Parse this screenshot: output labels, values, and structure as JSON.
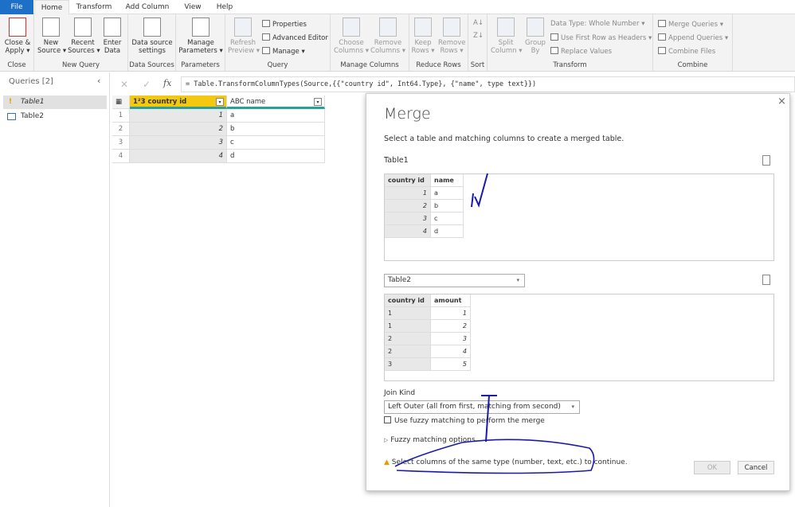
{
  "tabs": [
    "File",
    "Home",
    "Transform",
    "Add Column",
    "View",
    "Help"
  ],
  "ribbon": {
    "close": {
      "label": "Close",
      "btn": "Close &\nApply ▾"
    },
    "new_query": {
      "label": "New Query",
      "new_source": "New\nSource ▾",
      "recent": "Recent\nSources ▾",
      "enter": "Enter\nData"
    },
    "data_sources": {
      "label": "Data Sources",
      "btn": "Data source\nsettings"
    },
    "parameters": {
      "label": "Parameters",
      "btn": "Manage\nParameters ▾"
    },
    "query": {
      "label": "Query",
      "refresh": "Refresh\nPreview ▾",
      "properties": "Properties",
      "advanced": "Advanced Editor",
      "manage": "Manage ▾"
    },
    "manage_columns": {
      "label": "Manage Columns",
      "choose": "Choose\nColumns ▾",
      "remove": "Remove\nColumns ▾"
    },
    "reduce_rows": {
      "label": "Reduce Rows",
      "keep": "Keep\nRows ▾",
      "remove": "Remove\nRows ▾"
    },
    "sort": {
      "label": "Sort"
    },
    "transform": {
      "label": "Transform",
      "split": "Split\nColumn ▾",
      "group": "Group\nBy",
      "data_type": "Data Type: Whole Number ▾",
      "first_row": "Use First Row as Headers ▾",
      "replace": "Replace Values"
    },
    "combine": {
      "label": "Combine",
      "merge": "Merge Queries ▾",
      "append": "Append Queries ▾",
      "files": "Combine Files"
    }
  },
  "queries": {
    "title": "Queries [2]",
    "items": [
      "Table1",
      "Table2"
    ]
  },
  "formula": "= Table.TransformColumnTypes(Source,{{\"country id\", Int64.Type}, {\"name\", type text}})",
  "grid": {
    "columns": [
      "country id",
      "name"
    ],
    "column_types": [
      "1²3",
      "ABC"
    ],
    "rows": [
      [
        "1",
        "1",
        "a"
      ],
      [
        "2",
        "2",
        "b"
      ],
      [
        "3",
        "3",
        "c"
      ],
      [
        "4",
        "4",
        "d"
      ]
    ]
  },
  "dialog": {
    "title": "Merge",
    "subtitle": "Select a table and matching columns to create a merged table.",
    "table1_label": "Table1",
    "table1": {
      "columns": [
        "country id",
        "name"
      ],
      "rows": [
        [
          "1",
          "a"
        ],
        [
          "2",
          "b"
        ],
        [
          "3",
          "c"
        ],
        [
          "4",
          "d"
        ]
      ]
    },
    "table2_select": "Table2",
    "table2": {
      "columns": [
        "country id",
        "amount"
      ],
      "rows": [
        [
          "1",
          "1"
        ],
        [
          "1",
          "2"
        ],
        [
          "2",
          "3"
        ],
        [
          "2",
          "4"
        ],
        [
          "3",
          "5"
        ]
      ]
    },
    "join_kind_label": "Join Kind",
    "join_kind": "Left Outer (all from first, matching from second)",
    "fuzzy_checkbox": "Use fuzzy matching to perform the merge",
    "fuzzy_options": "Fuzzy matching options",
    "warning": "Select columns of the same type (number, text, etc.) to continue.",
    "ok": "OK",
    "cancel": "Cancel"
  },
  "colors": {
    "file_tab": "#1e6fc7",
    "selected_column": "#f2c811",
    "annotation": "#1a1aa8",
    "warning": "#e0a100"
  }
}
